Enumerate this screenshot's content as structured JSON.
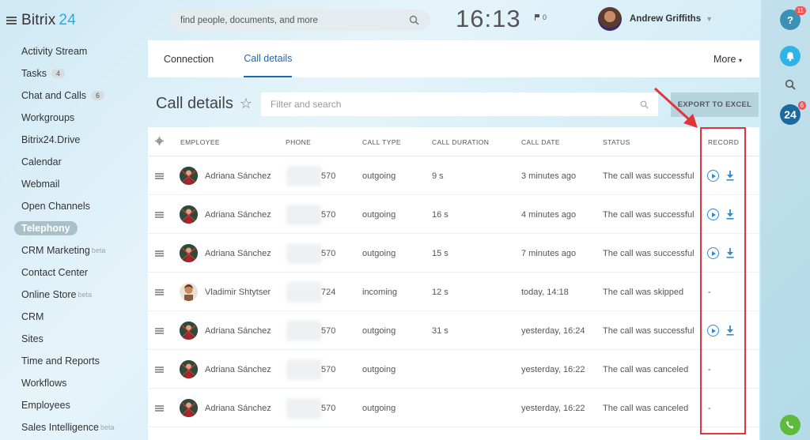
{
  "app": {
    "logo_text": "Bitrix",
    "logo_num": "24"
  },
  "header": {
    "search_placeholder": "find people, documents, and more",
    "clock": "16:13",
    "flag_count": "0",
    "user_name": "Andrew Griffiths"
  },
  "sidebar": {
    "items": [
      {
        "label": "Activity Stream",
        "counter": "",
        "sup": ""
      },
      {
        "label": "Tasks",
        "counter": "4",
        "sup": ""
      },
      {
        "label": "Chat and Calls",
        "counter": "6",
        "sup": ""
      },
      {
        "label": "Workgroups",
        "counter": "",
        "sup": ""
      },
      {
        "label": "Bitrix24.Drive",
        "counter": "",
        "sup": ""
      },
      {
        "label": "Calendar",
        "counter": "",
        "sup": ""
      },
      {
        "label": "Webmail",
        "counter": "",
        "sup": ""
      },
      {
        "label": "Open Channels",
        "counter": "",
        "sup": ""
      },
      {
        "label": "Telephony",
        "counter": "",
        "sup": ""
      },
      {
        "label": "CRM Marketing",
        "counter": "",
        "sup": "beta"
      },
      {
        "label": "Contact Center",
        "counter": "",
        "sup": ""
      },
      {
        "label": "Online Store",
        "counter": "",
        "sup": "beta"
      },
      {
        "label": "CRM",
        "counter": "",
        "sup": ""
      },
      {
        "label": "Sites",
        "counter": "",
        "sup": ""
      },
      {
        "label": "Time and Reports",
        "counter": "",
        "sup": ""
      },
      {
        "label": "Workflows",
        "counter": "",
        "sup": ""
      },
      {
        "label": "Employees",
        "counter": "",
        "sup": ""
      },
      {
        "label": "Sales Intelligence",
        "counter": "",
        "sup": "beta"
      }
    ]
  },
  "rail": {
    "help_badge": "11",
    "b24_badge": "6",
    "help_label": "?",
    "b24_label": "24"
  },
  "tabs": {
    "connection": "Connection",
    "call_details": "Call details",
    "more": "More"
  },
  "page": {
    "title": "Call details",
    "filter_placeholder": "Filter and search",
    "export_label": "EXPORT TO EXCEL"
  },
  "table": {
    "headers": {
      "employee": "EMPLOYEE",
      "phone": "PHONE",
      "call_type": "CALL TYPE",
      "call_duration": "CALL DURATION",
      "call_date": "CALL DATE",
      "status": "STATUS",
      "record": "RECORD"
    },
    "rows": [
      {
        "employee": "Adriana Sánchez",
        "phone": "570",
        "type": "outgoing",
        "duration": "9 s",
        "date": "3 minutes ago",
        "status": "The call was successful",
        "record": ""
      },
      {
        "employee": "Adriana Sánchez",
        "phone": "570",
        "type": "outgoing",
        "duration": "16 s",
        "date": "4 minutes ago",
        "status": "The call was successful",
        "record": ""
      },
      {
        "employee": "Adriana Sánchez",
        "phone": "570",
        "type": "outgoing",
        "duration": "15 s",
        "date": "7 minutes ago",
        "status": "The call was successful",
        "record": ""
      },
      {
        "employee": "Vladimir Shtytser",
        "phone": "724",
        "type": "incoming",
        "duration": "12 s",
        "date": "today, 14:18",
        "status": "The call was skipped",
        "record": "-"
      },
      {
        "employee": "Adriana Sánchez",
        "phone": "570",
        "type": "outgoing",
        "duration": "31 s",
        "date": "yesterday, 16:24",
        "status": "The call was successful",
        "record": ""
      },
      {
        "employee": "Adriana Sánchez",
        "phone": "570",
        "type": "outgoing",
        "duration": "",
        "date": "yesterday, 16:22",
        "status": "The call was canceled",
        "record": "-"
      },
      {
        "employee": "Adriana Sánchez",
        "phone": "570",
        "type": "outgoing",
        "duration": "",
        "date": "yesterday, 16:22",
        "status": "The call was canceled",
        "record": "-"
      }
    ]
  }
}
